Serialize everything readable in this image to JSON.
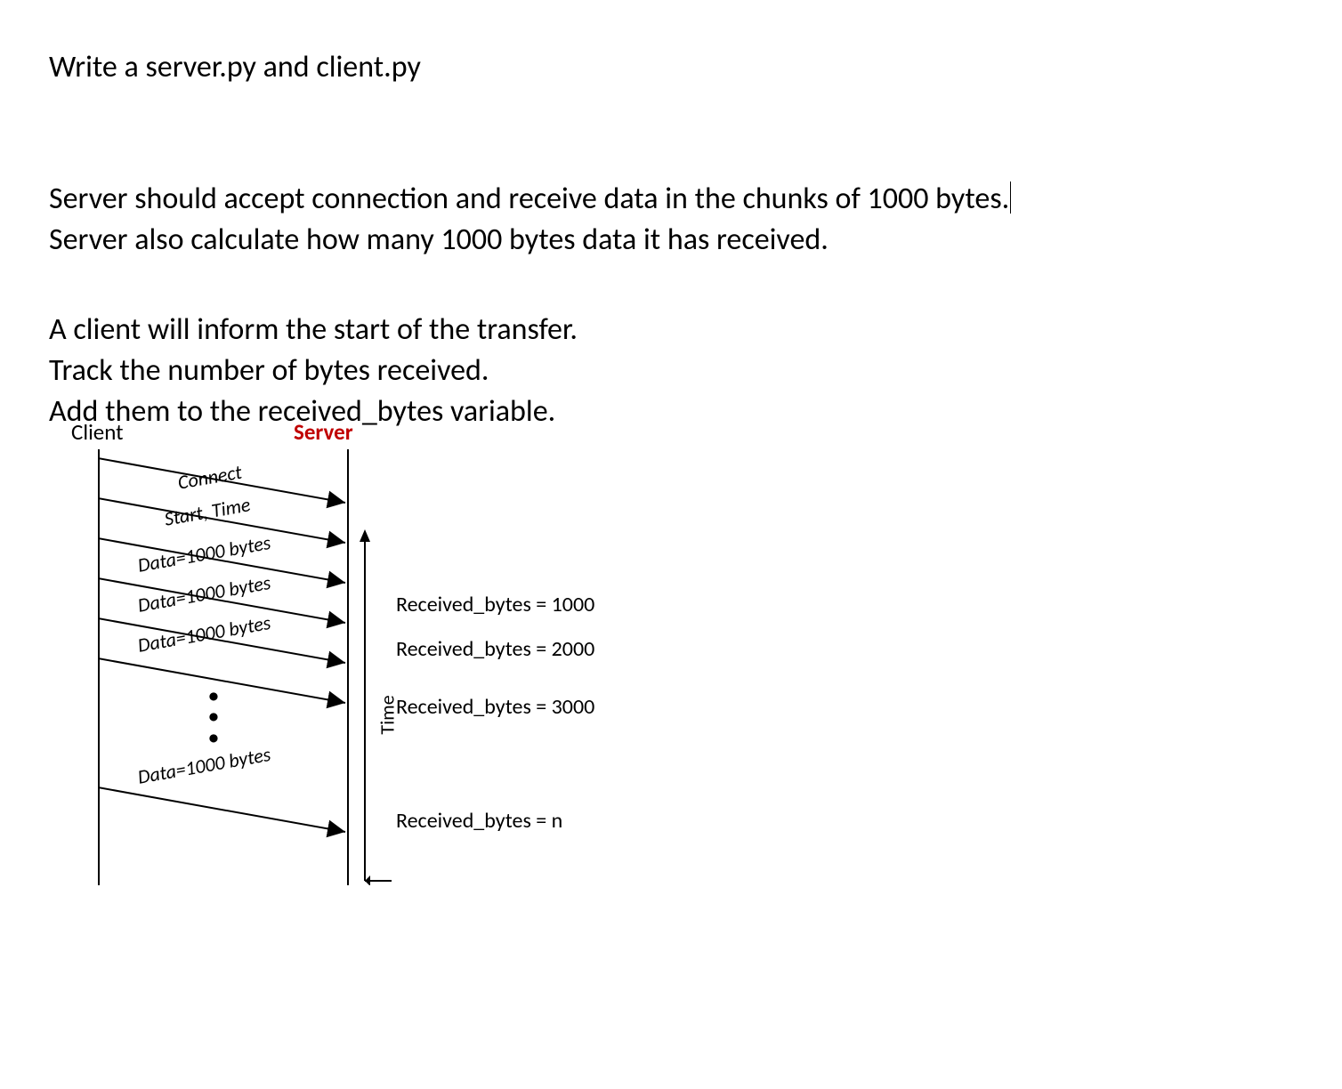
{
  "heading": "Write a server.py and client.py",
  "para1_line1": "Server should accept connection and receive data in the chunks of 1000 bytes.",
  "para1_line2": "Server also calculate how many 1000 bytes data it has received.",
  "para2_line1": "A client will inform the start of the transfer.",
  "para2_line2": "Track the number of bytes received.",
  "para2_line3": "Add them to the received_bytes variable.",
  "diagram": {
    "client_label": "Client",
    "server_label": "Server",
    "time_label": "Time",
    "messages": {
      "m1": "Connect",
      "m2": "Start, Time",
      "m3": "Data=1000 bytes",
      "m4": "Data=1000 bytes",
      "m5": "Data=1000 bytes",
      "m_last": "Data=1000 bytes"
    },
    "received": {
      "r1": "Received_bytes = 1000",
      "r2": "Received_bytes = 2000",
      "r3": "Received_bytes = 3000",
      "rn": "Received_bytes = n"
    }
  }
}
